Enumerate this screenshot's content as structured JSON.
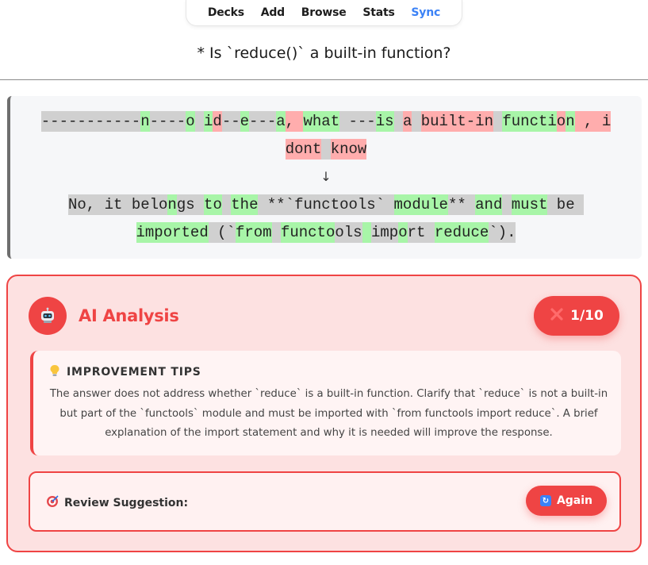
{
  "nav": {
    "items": [
      {
        "label": "Decks"
      },
      {
        "label": "Add"
      },
      {
        "label": "Browse"
      },
      {
        "label": "Stats"
      },
      {
        "label": "Sync"
      }
    ],
    "active": "Sync"
  },
  "question": "* Is `reduce()` a built-in function?",
  "diff": {
    "typed_line1": [
      {
        "t": "-----------",
        "k": "g"
      },
      {
        "t": "n",
        "k": "a"
      },
      {
        "t": "----",
        "k": "g"
      },
      {
        "t": "o",
        "k": "a"
      },
      {
        "t": " ",
        "k": "g"
      },
      {
        "t": "i",
        "k": "a"
      },
      {
        "t": "d",
        "k": "r"
      },
      {
        "t": "--",
        "k": "g"
      },
      {
        "t": "e",
        "k": "a"
      },
      {
        "t": "---",
        "k": "g"
      },
      {
        "t": "a",
        "k": "a"
      },
      {
        "t": ", ",
        "k": "r"
      },
      {
        "t": "what",
        "k": "a"
      },
      {
        "t": " ",
        "k": "g"
      },
      {
        "t": "---",
        "k": "g"
      },
      {
        "t": "is",
        "k": "a"
      },
      {
        "t": " ",
        "k": "g"
      },
      {
        "t": "a",
        "k": "r"
      },
      {
        "t": " ",
        "k": "g"
      },
      {
        "t": "built-in",
        "k": "r"
      },
      {
        "t": " ",
        "k": "g"
      },
      {
        "t": "functi",
        "k": "a"
      },
      {
        "t": "o",
        "k": "r"
      },
      {
        "t": "n",
        "k": "a"
      },
      {
        "t": " , i",
        "k": "r"
      }
    ],
    "typed_line2": [
      {
        "t": "dont",
        "k": "r"
      },
      {
        "t": " ",
        "k": "g"
      },
      {
        "t": "know",
        "k": "r"
      }
    ],
    "arrow": "↓",
    "expected_line1": [
      {
        "t": "No, it belo",
        "k": "g"
      },
      {
        "t": "n",
        "k": "a"
      },
      {
        "t": "gs ",
        "k": "g"
      },
      {
        "t": "to",
        "k": "a"
      },
      {
        "t": " ",
        "k": "g"
      },
      {
        "t": "the",
        "k": "a"
      },
      {
        "t": " **`functools` ",
        "k": "g"
      },
      {
        "t": "module",
        "k": "a"
      },
      {
        "t": "** ",
        "k": "g"
      },
      {
        "t": "and",
        "k": "a"
      },
      {
        "t": " ",
        "k": "g"
      },
      {
        "t": "must",
        "k": "a"
      },
      {
        "t": " be ",
        "k": "g"
      }
    ],
    "expected_line2": [
      {
        "t": "imported",
        "k": "a"
      },
      {
        "t": " (`",
        "k": "g"
      },
      {
        "t": "from",
        "k": "a"
      },
      {
        "t": " ",
        "k": "g"
      },
      {
        "t": "functo",
        "k": "a"
      },
      {
        "t": "ols",
        "k": "g"
      },
      {
        "t": " ",
        "k": "a"
      },
      {
        "t": "imp",
        "k": "g"
      },
      {
        "t": "o",
        "k": "a"
      },
      {
        "t": "rt",
        "k": "g"
      },
      {
        "t": " ",
        "k": "g"
      },
      {
        "t": "reduce",
        "k": "a"
      },
      {
        "t": "`).",
        "k": "g"
      }
    ]
  },
  "analysis": {
    "title": "AI Analysis",
    "score": "1/10",
    "tips_heading": "IMPROVEMENT TIPS",
    "tips_body": "The answer does not address whether `reduce` is a built-in function. Clarify that `reduce` is not a built-in but part of the `functools` module and must be imported with `from functools import reduce`. A brief explanation of the import statement and why it is needed will improve the response.",
    "review_label": "Review Suggestion:",
    "again_label": "Again"
  },
  "colors": {
    "accent": "#ef4444",
    "active_nav": "#3b82f6",
    "diff_added": "#a8f5a8",
    "diff_removed": "#ffadad",
    "diff_neutral": "#d0d0d0"
  },
  "icons": {
    "score": "x-mark-icon",
    "avatar": "robot-icon",
    "tips": "lightbulb-icon",
    "review": "target-icon",
    "again": "refresh-icon"
  }
}
